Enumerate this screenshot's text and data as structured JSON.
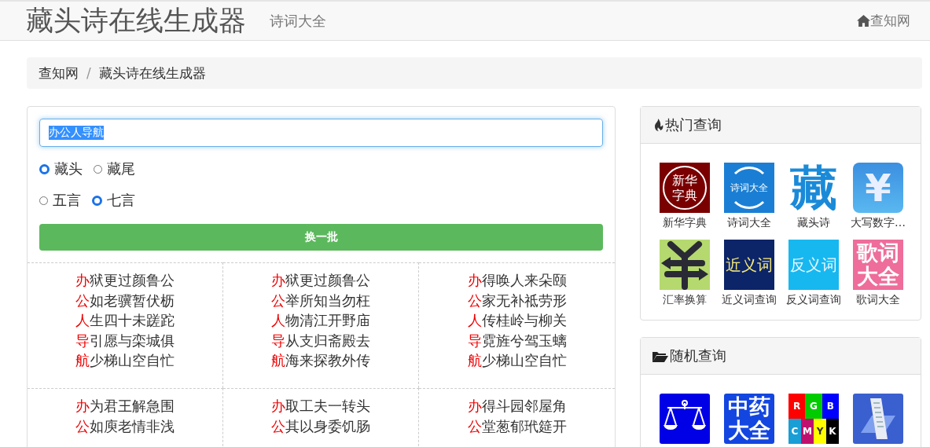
{
  "header": {
    "title": "藏头诗在线生成器",
    "subtitle": "诗词大全",
    "home_link": "查知网"
  },
  "breadcrumb": {
    "separator": "/",
    "items": [
      "查知网",
      "藏头诗在线生成器"
    ]
  },
  "form": {
    "input": {
      "value": "办公人导航",
      "highlighted": true
    },
    "radio_groups": [
      [
        {
          "label": "藏头",
          "selected": true
        },
        {
          "label": "藏尾",
          "selected": false
        }
      ],
      [
        {
          "label": "五言",
          "selected": false
        },
        {
          "label": "七言",
          "selected": true
        }
      ]
    ],
    "button": "换一批"
  },
  "poems": [
    {
      "lines": [
        {
          "head": "办",
          "rest": "狱更过颜鲁公"
        },
        {
          "head": "公",
          "rest": "如老骥暂伏枥"
        },
        {
          "head": "人",
          "rest": "生四十未蹉跎"
        },
        {
          "head": "导",
          "rest": "引愿与栾城俱"
        },
        {
          "head": "航",
          "rest": "少梯山空自忙"
        }
      ]
    },
    {
      "lines": [
        {
          "head": "办",
          "rest": "狱更过颜鲁公"
        },
        {
          "head": "公",
          "rest": "举所知当勿枉"
        },
        {
          "head": "人",
          "rest": "物清江开野庙"
        },
        {
          "head": "导",
          "rest": "从支归斋殿去"
        },
        {
          "head": "航",
          "rest": "海来探教外传"
        }
      ]
    },
    {
      "lines": [
        {
          "head": "办",
          "rest": "得唤人来朵颐"
        },
        {
          "head": "公",
          "rest": "家无补祗劳形"
        },
        {
          "head": "人",
          "rest": "传桂岭与柳关"
        },
        {
          "head": "导",
          "rest": "霓旌兮驾玉螭"
        },
        {
          "head": "航",
          "rest": "少梯山空自忙"
        }
      ]
    },
    {
      "lines": [
        {
          "head": "办",
          "rest": "为君王解急围"
        },
        {
          "head": "公",
          "rest": "如庾老情非浅"
        }
      ]
    },
    {
      "lines": [
        {
          "head": "办",
          "rest": "取工夫一转头"
        },
        {
          "head": "公",
          "rest": "其以身委饥肠"
        }
      ]
    },
    {
      "lines": [
        {
          "head": "办",
          "rest": "得斗园邻屋角"
        },
        {
          "head": "公",
          "rest": "堂葱郁玳筵开"
        }
      ]
    }
  ],
  "panels": [
    {
      "title": "热门查询",
      "tiles": [
        {
          "kind": "seal",
          "logo_text": [
            "新华",
            "字典"
          ],
          "label": "新华字典"
        },
        {
          "kind": "ring",
          "logo_text": [
            "诗词大全"
          ],
          "label": "诗词大全"
        },
        {
          "kind": "glyph",
          "logo_text": [
            "藏"
          ],
          "label": "藏头诗"
        },
        {
          "kind": "yen",
          "logo_text": [
            "¥"
          ],
          "label": "大写数字…"
        },
        {
          "kind": "exchange",
          "label": "汇率换算"
        },
        {
          "kind": "navy",
          "logo_text": [
            "近义词"
          ],
          "label": "近义词查询"
        },
        {
          "kind": "sky",
          "logo_text": [
            "反义词"
          ],
          "label": "反义词查询"
        },
        {
          "kind": "pink",
          "logo_text": [
            "歌词",
            "大全"
          ],
          "label": "歌词大全"
        }
      ]
    },
    {
      "title": "随机查询",
      "tiles": [
        {
          "kind": "scale"
        },
        {
          "kind": "herb",
          "logo_text": [
            "中药",
            "大全"
          ]
        },
        {
          "kind": "cmyk",
          "logo_text": [
            "R",
            "G",
            "B",
            "C",
            "M",
            "Y",
            "K"
          ]
        },
        {
          "kind": "ruler"
        }
      ]
    }
  ]
}
